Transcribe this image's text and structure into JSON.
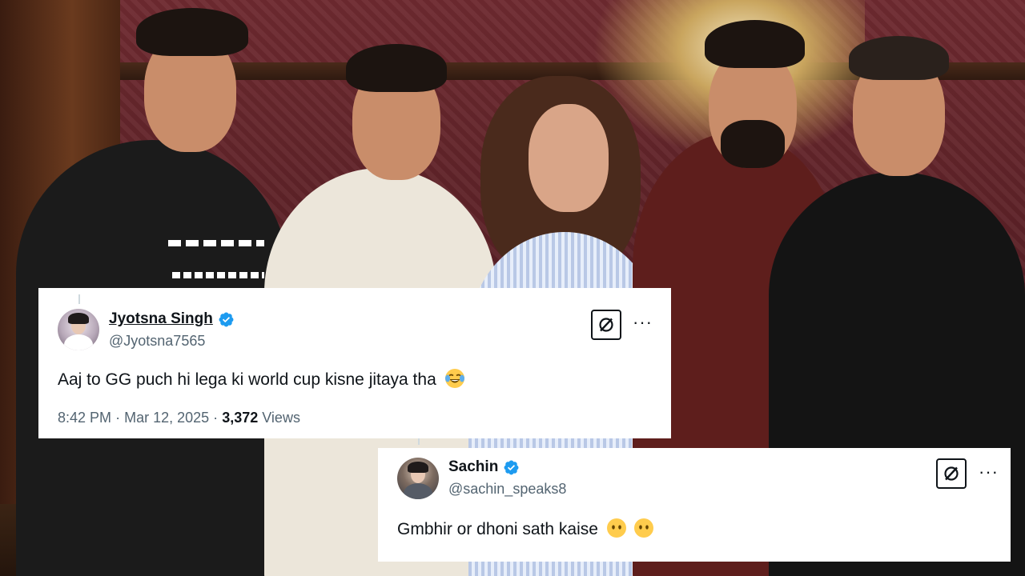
{
  "tweets": [
    {
      "display_name": "Jyotsna Singh",
      "handle": "@Jyotsna7565",
      "verified": true,
      "text": "Aaj to GG puch hi lega ki world cup kisne jitaya tha",
      "emoji": [
        "face-with-tears-of-joy"
      ],
      "time": "8:42 PM",
      "separator": "·",
      "date": "Mar 12, 2025",
      "views_count": "3,372",
      "views_label": "Views",
      "more_label": "···"
    },
    {
      "display_name": "Sachin",
      "handle": "@sachin_speaks8",
      "verified": true,
      "text": "Gmbhir or dhoni sath kaise",
      "emoji": [
        "face-without-mouth",
        "face-without-mouth"
      ],
      "more_label": "···"
    }
  ],
  "colors": {
    "verified_blue": "#1d9bf0",
    "text_primary": "#0f1419",
    "text_secondary": "#536471",
    "card_background": "#ffffff"
  },
  "icons": {
    "verified": "verified-badge-icon",
    "x_logo": "x-logo-icon",
    "more": "more-options-icon"
  }
}
